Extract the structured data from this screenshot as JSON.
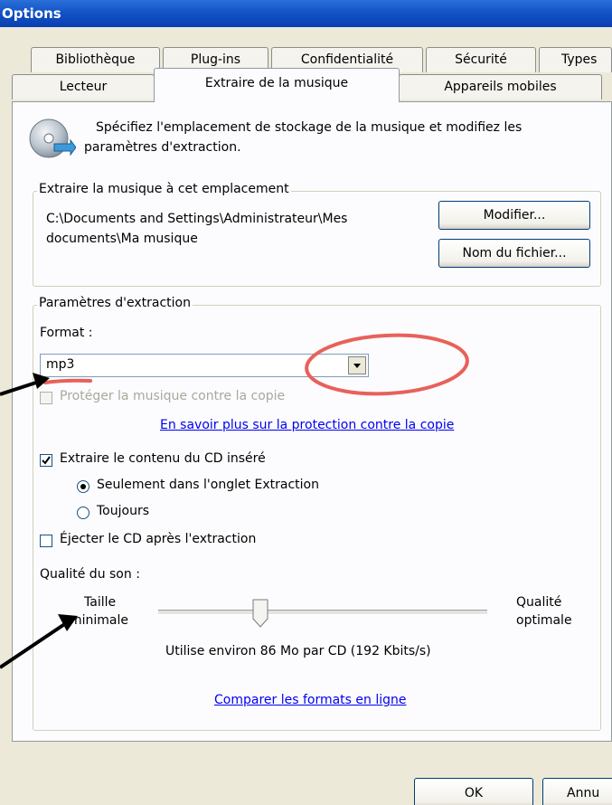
{
  "window": {
    "title": "Options"
  },
  "tabs_row1": [
    "Bibliothèque",
    "Plug-ins",
    "Confidentialité",
    "Sécurité",
    "Types"
  ],
  "tabs_row2": [
    "Lecteur",
    "Extraire de la musique",
    "Appareils mobiles"
  ],
  "active_tab": "Extraire de la musique",
  "intro_text_line1": "Spécifiez l'emplacement de stockage de la musique et modifiez les",
  "intro_text_line2": "paramètres d'extraction.",
  "location_group": {
    "legend": "Extraire la musique à cet emplacement",
    "path_line1": "C:\\Documents and Settings\\Administrateur\\Mes",
    "path_line2": "documents\\Ma musique",
    "modify_button": "Modifier...",
    "filename_button": "Nom du fichier..."
  },
  "settings_group": {
    "legend": "Paramètres d'extraction",
    "format_label": "Format :",
    "format_value": "mp3",
    "copy_protect_label": "Protéger la musique contre la copie",
    "copy_protect_checked": false,
    "copy_protect_enabled": false,
    "learn_more_link": "En savoir plus sur la protection contre la copie",
    "rip_cd_label": "Extraire le contenu du CD inséré",
    "rip_cd_checked": true,
    "radio_only_tab": "Seulement dans l'onglet Extraction",
    "radio_always": "Toujours",
    "selected_radio": "Seulement dans l'onglet Extraction",
    "eject_label": "Éjecter le CD après l'extraction",
    "eject_checked": false,
    "quality_label": "Qualité du son :",
    "quality_min_line1": "Taille",
    "quality_min_line2": "minimale",
    "quality_max_line1": "Qualité",
    "quality_max_line2": "optimale",
    "quality_level": 0.31,
    "quality_info": "Utilise environ 86 Mo par CD (192 Kbits/s)",
    "compare_link": "Comparer les formats en ligne"
  },
  "footer": {
    "ok_button": "OK",
    "cancel_button": "Annu"
  },
  "annotation_color": "#e8615a"
}
